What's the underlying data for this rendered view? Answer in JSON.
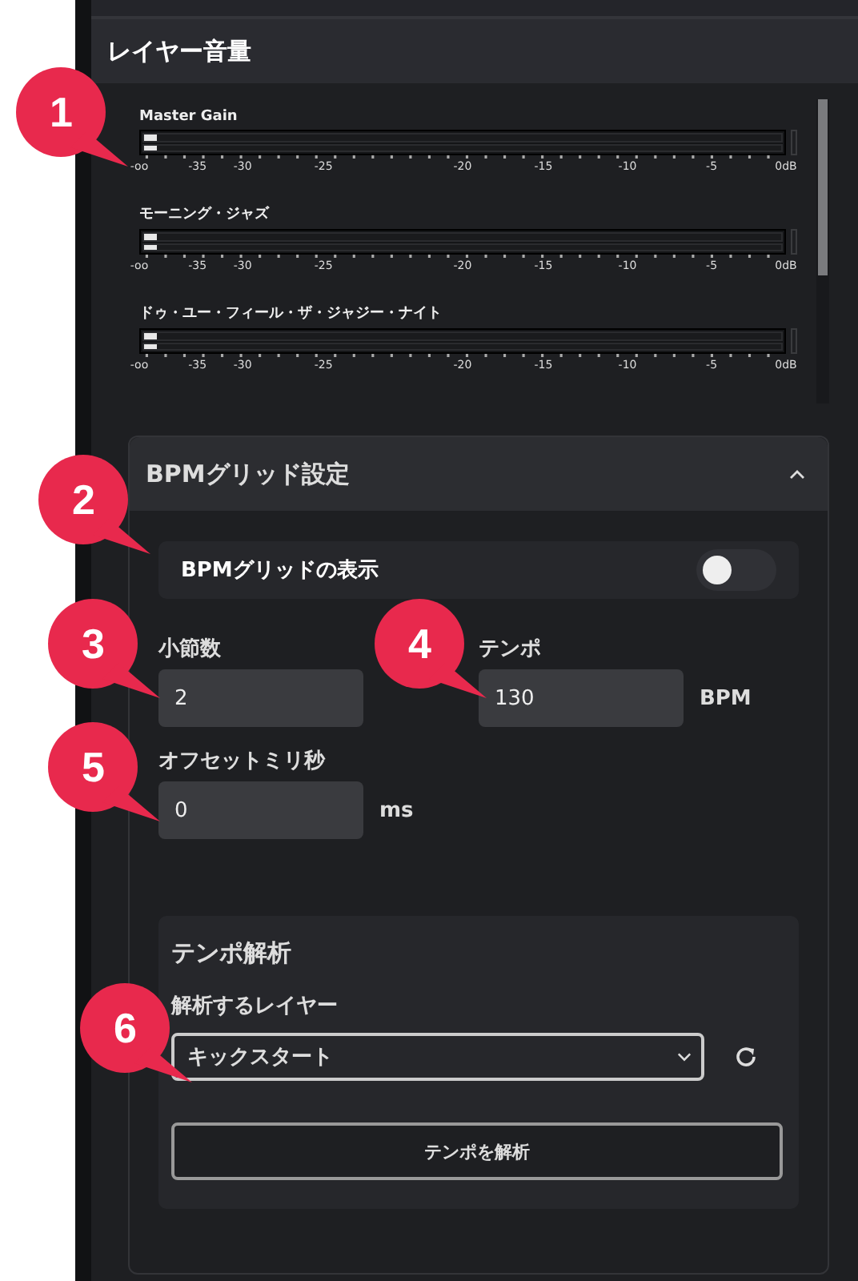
{
  "layer_volume": {
    "title": "レイヤー音量",
    "meters": [
      {
        "name": "Master Gain",
        "level": 0.02,
        "scale": [
          "-oo",
          "-35",
          "-30",
          "-25",
          "-20",
          "-15",
          "-10",
          "-5",
          "0dB"
        ]
      },
      {
        "name": "モーニング・ジャズ",
        "level": 0.02,
        "scale": [
          "-oo",
          "-35",
          "-30",
          "-25",
          "-20",
          "-15",
          "-10",
          "-5",
          "0dB"
        ]
      },
      {
        "name": "ドゥ・ユー・フィール・ザ・ジャジー・ナイト",
        "level": 0.02,
        "scale": [
          "-oo",
          "-35",
          "-30",
          "-25",
          "-20",
          "-15",
          "-10",
          "-5",
          "0dB"
        ]
      }
    ]
  },
  "bpm_grid": {
    "title": "BPMグリッド設定",
    "expanded": true,
    "show_grid": {
      "label": "BPMグリッドの表示",
      "on": false
    },
    "bars": {
      "label": "小節数",
      "value": "2"
    },
    "tempo": {
      "label": "テンポ",
      "value": "130",
      "unit": "BPM"
    },
    "offset": {
      "label": "オフセットミリ秒",
      "value": "0",
      "unit": "ms"
    },
    "analysis": {
      "title": "テンポ解析",
      "layer_label": "解析するレイヤー",
      "layer_value": "キックスタート",
      "button": "テンポを解析"
    }
  },
  "callouts": [
    "1",
    "2",
    "3",
    "4",
    "5",
    "6"
  ]
}
